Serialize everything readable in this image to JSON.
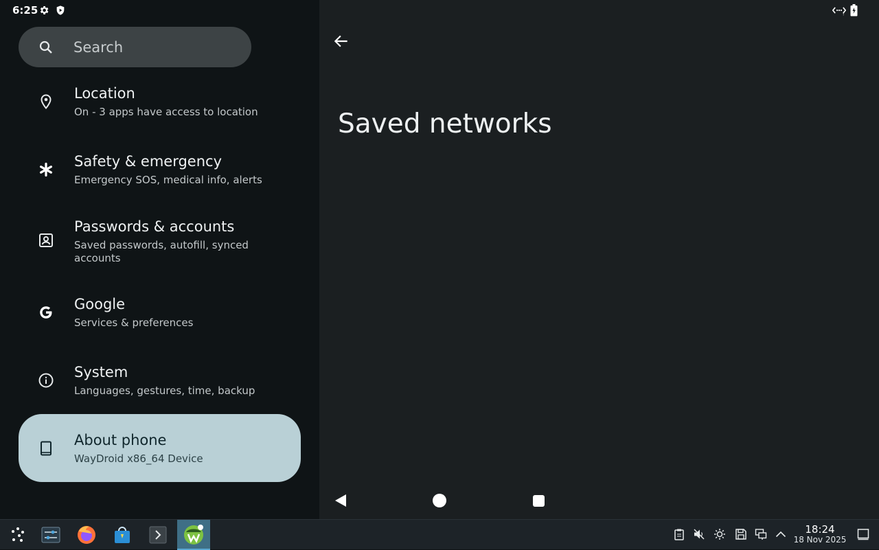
{
  "status_bar": {
    "time": "6:25",
    "left_icons": [
      "gear-icon",
      "shield-icon"
    ],
    "right_icons": [
      "ethernet-icon",
      "battery-icon"
    ]
  },
  "search": {
    "placeholder": "Search"
  },
  "menu": {
    "items": [
      {
        "title": "Location",
        "subtitle": "On - 3 apps have access to location",
        "icon": "location-pin-icon"
      },
      {
        "title": "Safety & emergency",
        "subtitle": "Emergency SOS, medical info, alerts",
        "icon": "asterisk-icon"
      },
      {
        "title": "Passwords & accounts",
        "subtitle": "Saved passwords, autofill, synced accounts",
        "icon": "account-box-icon"
      },
      {
        "title": "Google",
        "subtitle": "Services & preferences",
        "icon": "google-icon"
      },
      {
        "title": "System",
        "subtitle": "Languages, gestures, time, backup",
        "icon": "info-icon"
      },
      {
        "title": "About phone",
        "subtitle": "WayDroid x86_64 Device",
        "icon": "tablet-icon",
        "selected": true
      }
    ]
  },
  "detail": {
    "title": "Saved networks"
  },
  "taskbar": {
    "apps": [
      "app-launcher-icon",
      "settings-sliders-icon",
      "firefox-icon",
      "store-icon",
      "terminal-icon",
      "waydroid-icon"
    ],
    "tray": [
      "clipboard-icon",
      "volume-muted-icon",
      "brightness-icon",
      "save-icon",
      "network-icon",
      "chevron-up-icon"
    ],
    "clock_time": "18:24",
    "clock_date": "18 Nov 2025"
  },
  "colors": {
    "left_pane_bg": "#0f1416",
    "right_pane_bg": "#1b1f21",
    "selected_item_bg": "#b9d0d6",
    "search_bg": "#3d4345",
    "taskbar_bg": "#1d2328"
  }
}
